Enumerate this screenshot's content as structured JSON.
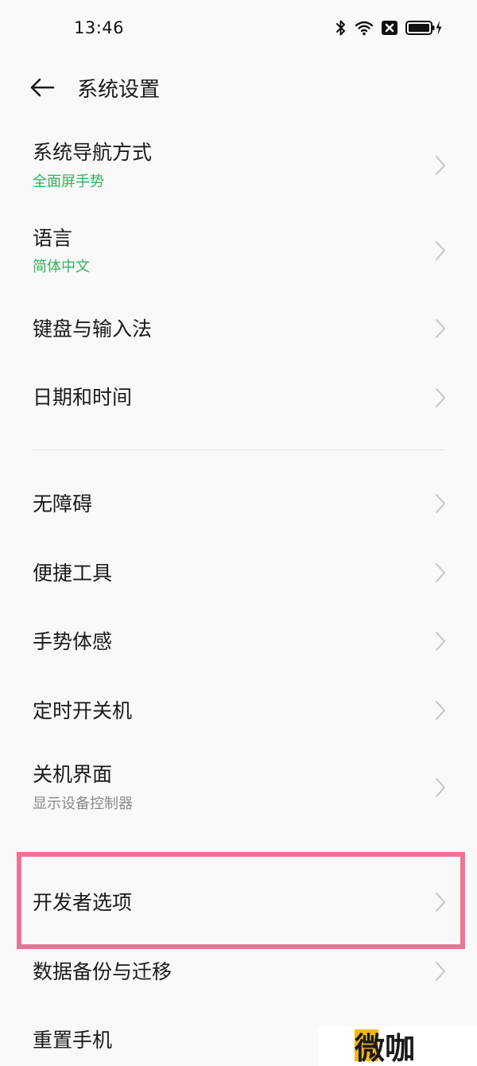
{
  "status_bar": {
    "time": "13:46",
    "icons": [
      "bluetooth-icon",
      "wifi-icon",
      "close-box-icon",
      "battery-charging-icon"
    ]
  },
  "header": {
    "back_icon": "arrow-left-icon",
    "title": "系统设置"
  },
  "settings": [
    {
      "label": "系统导航方式",
      "sub": "全面屏手势",
      "sub_color": "#2fb35a"
    },
    {
      "label": "语言",
      "sub": "简体中文",
      "sub_color": "#2fb35a"
    },
    {
      "label": "键盘与输入法"
    },
    {
      "label": "日期和时间"
    },
    {
      "label": "无障碍"
    },
    {
      "label": "便捷工具"
    },
    {
      "label": "手势体感"
    },
    {
      "label": "定时开关机"
    },
    {
      "label": "关机界面",
      "sub": "显示设备控制器",
      "sub_color": "#8a8a8a"
    },
    {
      "label": "开发者选项",
      "highlighted": true
    },
    {
      "label": "数据备份与迁移"
    },
    {
      "label": "重置手机"
    }
  ],
  "colors": {
    "accent_green": "#2fb35a",
    "highlight_pink": "#ef7297",
    "background": "#f9f9f9",
    "chevron_gray": "#c4c4c4"
  },
  "watermark": {
    "text": "微咖"
  }
}
